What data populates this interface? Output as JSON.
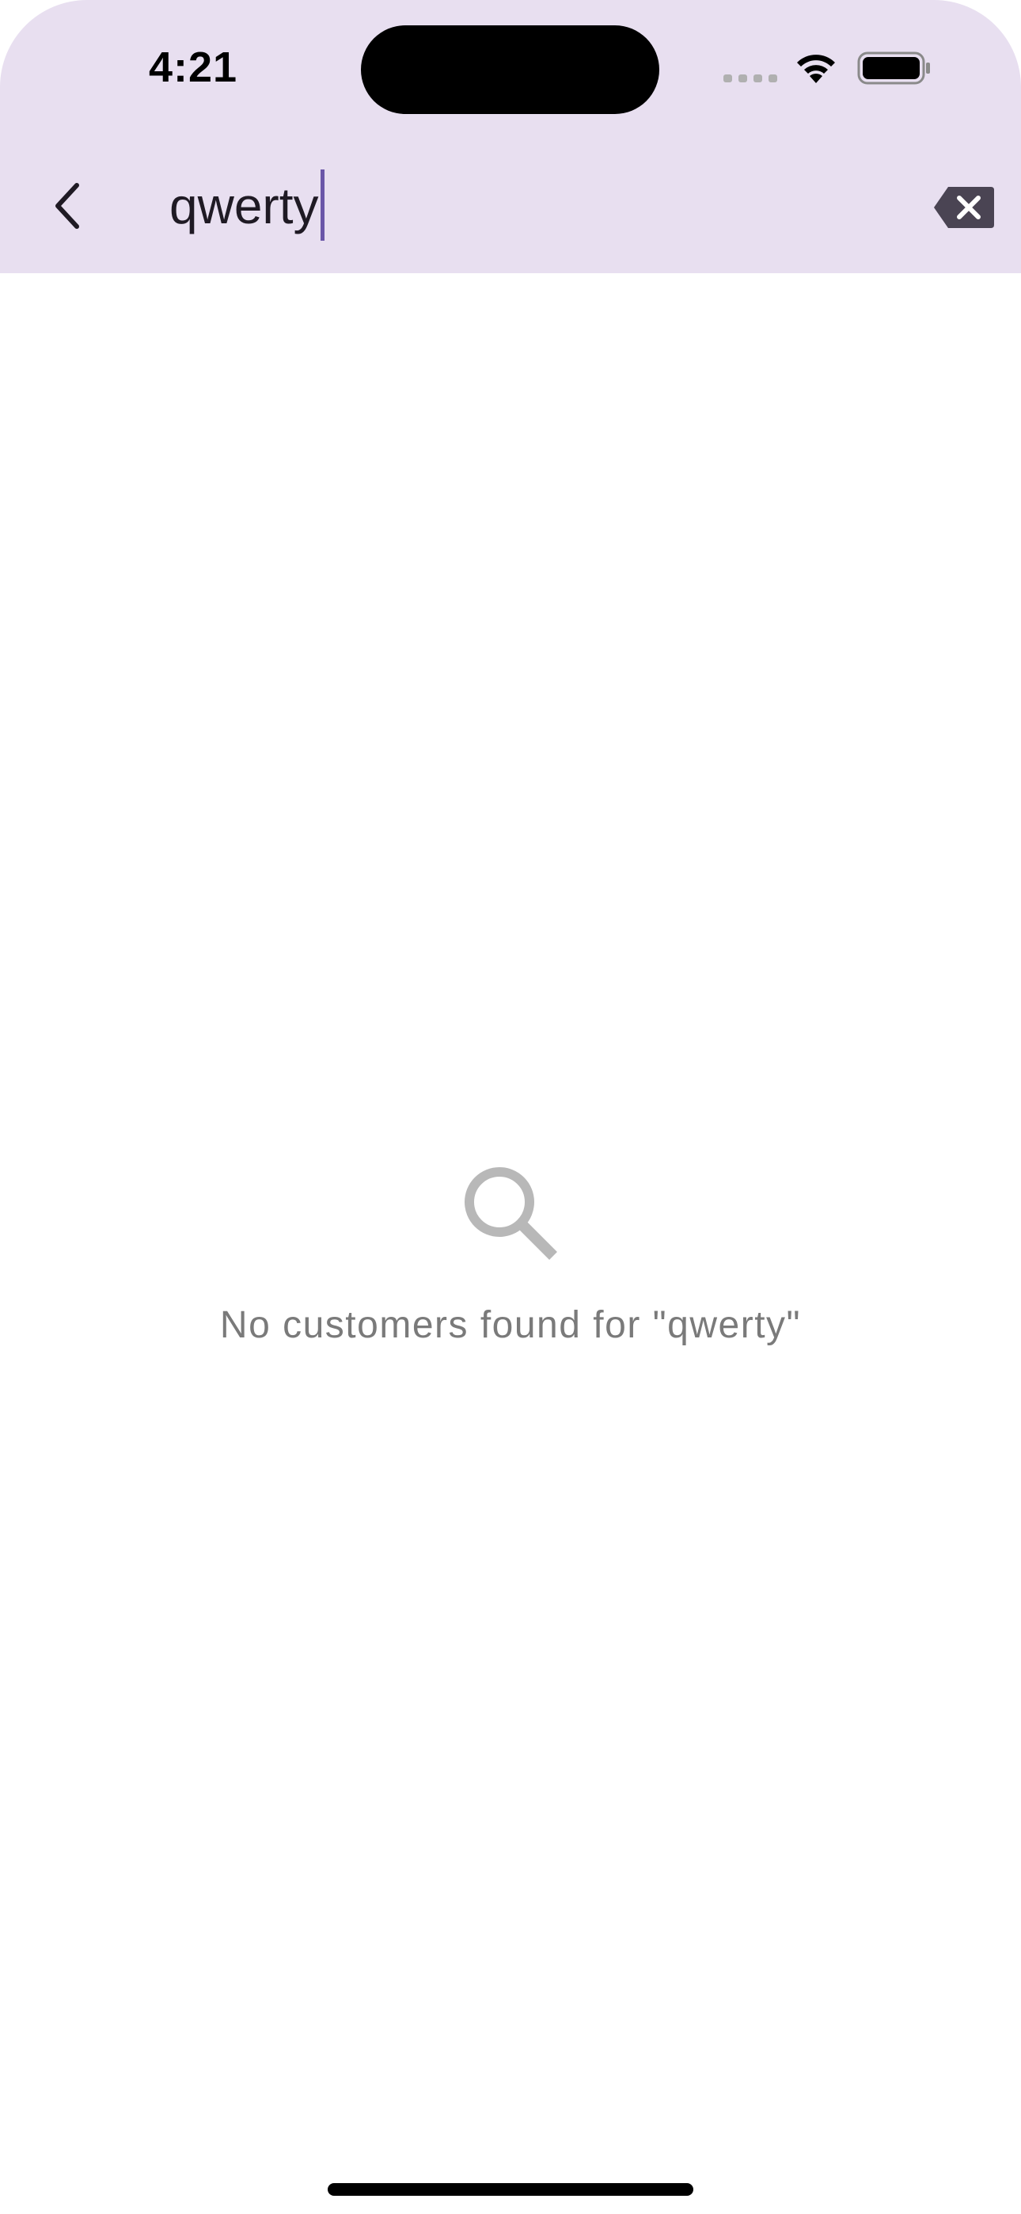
{
  "status_bar": {
    "time": "4:21"
  },
  "search": {
    "value": "qwerty",
    "back_icon": "chevron-left-icon",
    "clear_icon": "backspace-clear-icon"
  },
  "empty_state": {
    "icon": "search-icon",
    "message": "No customers found for \"qwerty\""
  },
  "colors": {
    "header_background": "#e8dff0",
    "cursor": "#6a56a8",
    "empty_text": "#7a7a7a",
    "empty_icon": "#b8b8b8"
  }
}
